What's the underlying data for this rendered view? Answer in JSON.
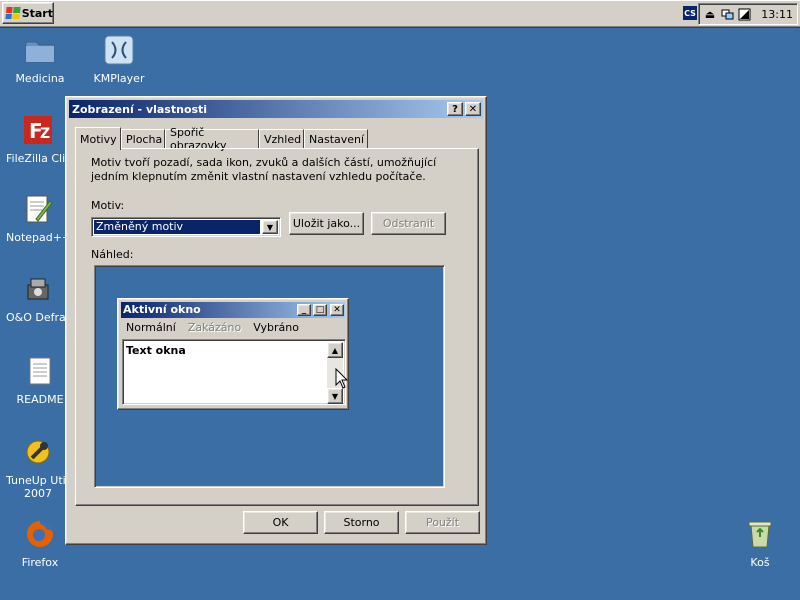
{
  "taskbar": {
    "start_label": "Start",
    "lang_indicator": "CS",
    "clock": "13:11",
    "tray_icons": [
      "eject-icon",
      "network-icon",
      "sound-icon"
    ]
  },
  "desktop": {
    "icons": [
      {
        "name": "Medicina",
        "icon": "folder-icon"
      },
      {
        "name": "KMPlayer",
        "icon": "kmplayer-icon"
      },
      {
        "name": "FileZilla Client",
        "icon": "filezilla-icon"
      },
      {
        "name": "Notepad++",
        "icon": "notepad-icon"
      },
      {
        "name": "O&O Defrag",
        "icon": "defrag-icon"
      },
      {
        "name": "README",
        "icon": "document-icon"
      },
      {
        "name": "TuneUp Utilities",
        "name2": "2007",
        "icon": "tuneup-icon"
      },
      {
        "name": "Firefox",
        "icon": "firefox-icon"
      },
      {
        "name": "Koš",
        "icon": "recycle-bin-icon"
      }
    ]
  },
  "dialog": {
    "title": "Zobrazení - vlastnosti",
    "help_btn": "?",
    "close_btn": "✕",
    "tabs": [
      "Motivy",
      "Plocha",
      "Spořič obrazovky",
      "Vzhled",
      "Nastavení"
    ],
    "active_tab": "Motivy",
    "description_line1": "Motiv tvoří pozadí, sada ikon, zvuků a dalších částí, umožňující",
    "description_line2": "jedním klepnutím změnit vlastní nastavení vzhledu počítače.",
    "theme_label": "Motiv:",
    "theme_value": "Změněný motiv",
    "save_as_label": "Uložit jako...",
    "delete_label": "Odstranit",
    "preview_label": "Náhled:",
    "preview_window": {
      "title": "Aktivní okno",
      "menu_normal": "Normální",
      "menu_disabled": "Zakázáno",
      "menu_selected": "Vybráno",
      "client_text": "Text okna"
    },
    "ok_label": "OK",
    "cancel_label": "Storno",
    "apply_label": "Použít"
  },
  "colors": {
    "desktop": "#3a6ea5",
    "title_active_start": "#0a246a",
    "title_active_end": "#a6caf0",
    "face": "#d4d0c8"
  }
}
